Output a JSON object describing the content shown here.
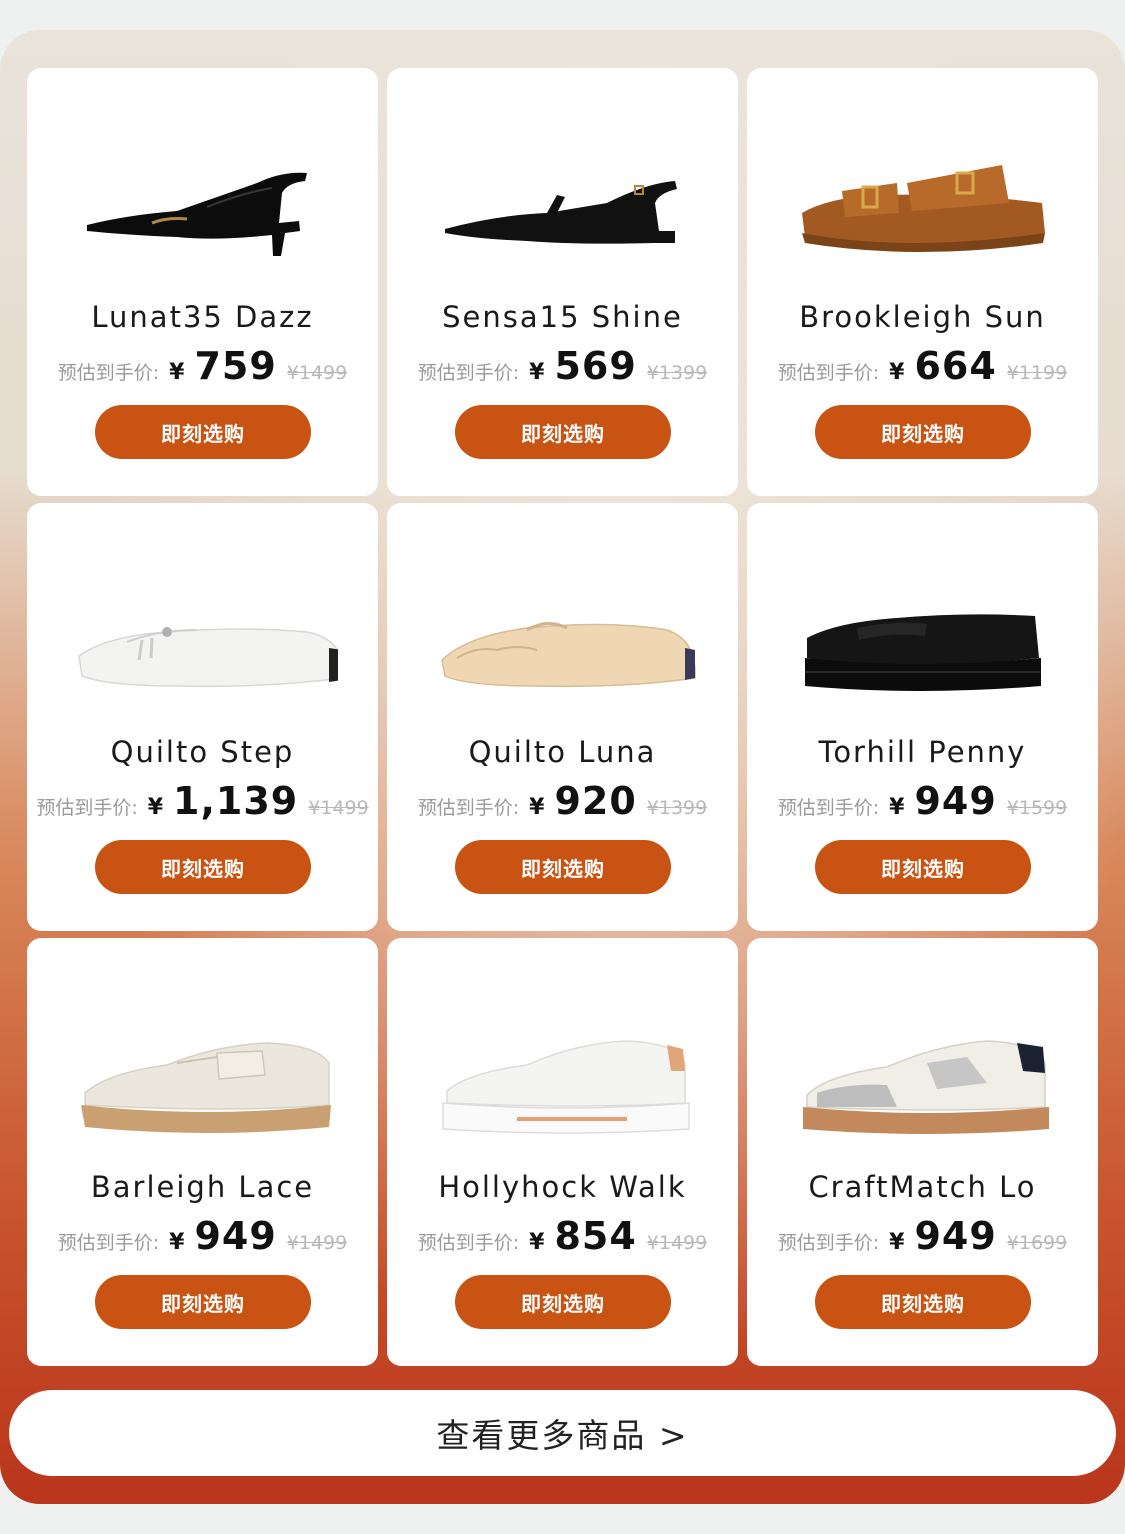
{
  "products": [
    {
      "name": "Lunat35 Dazz",
      "est_label": "预估到手价:",
      "currency": "¥",
      "price": "759",
      "original": "¥1499",
      "button": "即刻选购",
      "icon": "slingback-heel-icon"
    },
    {
      "name": "Sensa15 Shine",
      "est_label": "预估到手价:",
      "currency": "¥",
      "price": "569",
      "original": "¥1399",
      "button": "即刻选购",
      "icon": "slingback-flat-icon"
    },
    {
      "name": "Brookleigh Sun",
      "est_label": "预估到手价:",
      "currency": "¥",
      "price": "664",
      "original": "¥1199",
      "button": "即刻选购",
      "icon": "sandal-icon"
    },
    {
      "name": "Quilto Step",
      "est_label": "预估到手价:",
      "currency": "¥",
      "price": "1,139",
      "original": "¥1499",
      "button": "即刻选购",
      "icon": "white-loafer-icon"
    },
    {
      "name": "Quilto Luna",
      "est_label": "预估到手价:",
      "currency": "¥",
      "price": "920",
      "original": "¥1399",
      "button": "即刻选购",
      "icon": "beige-loafer-icon"
    },
    {
      "name": "Torhill Penny",
      "est_label": "预估到手价:",
      "currency": "¥",
      "price": "949",
      "original": "¥1599",
      "button": "即刻选购",
      "icon": "penny-loafer-icon"
    },
    {
      "name": "Barleigh Lace",
      "est_label": "预估到手价:",
      "currency": "¥",
      "price": "949",
      "original": "¥1499",
      "button": "即刻选购",
      "icon": "crepe-sneaker-icon"
    },
    {
      "name": "Hollyhock Walk",
      "est_label": "预估到手价:",
      "currency": "¥",
      "price": "854",
      "original": "¥1499",
      "button": "即刻选购",
      "icon": "white-sneaker-icon"
    },
    {
      "name": "CraftMatch Lo",
      "est_label": "预估到手价:",
      "currency": "¥",
      "price": "949",
      "original": "¥1699",
      "button": "即刻选购",
      "icon": "retro-sneaker-icon"
    }
  ],
  "more_button": "查看更多商品 >",
  "colors": {
    "accent": "#c95312",
    "card": "#ffffff"
  }
}
